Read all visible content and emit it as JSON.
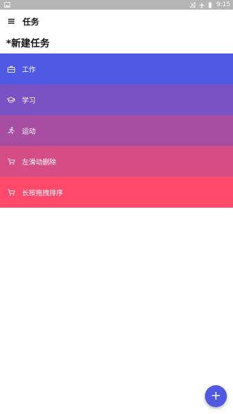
{
  "status_bar": {
    "time": "9:15",
    "icons": [
      "image-notification-icon",
      "no-signal-icon",
      "airplane-mode-icon",
      "battery-icon"
    ]
  },
  "app_bar": {
    "menu_icon": "hamburger-menu-icon",
    "title": "任务"
  },
  "section": {
    "title": "*新建任务"
  },
  "tasks": [
    {
      "label": "工作",
      "icon": "briefcase-icon",
      "color": "#5059E3"
    },
    {
      "label": "学习",
      "icon": "graduation-cap-icon",
      "color": "#7B52C4"
    },
    {
      "label": "运动",
      "icon": "running-icon",
      "color": "#A84EA2"
    },
    {
      "label": "左滑动删除",
      "icon": "shopping-cart-icon",
      "color": "#D54D84"
    },
    {
      "label": "长按拖拽排序",
      "icon": "shopping-cart-icon",
      "color": "#FF4A6C"
    }
  ],
  "fab": {
    "icon": "plus-icon",
    "label": "+",
    "color": "#5159E3"
  }
}
